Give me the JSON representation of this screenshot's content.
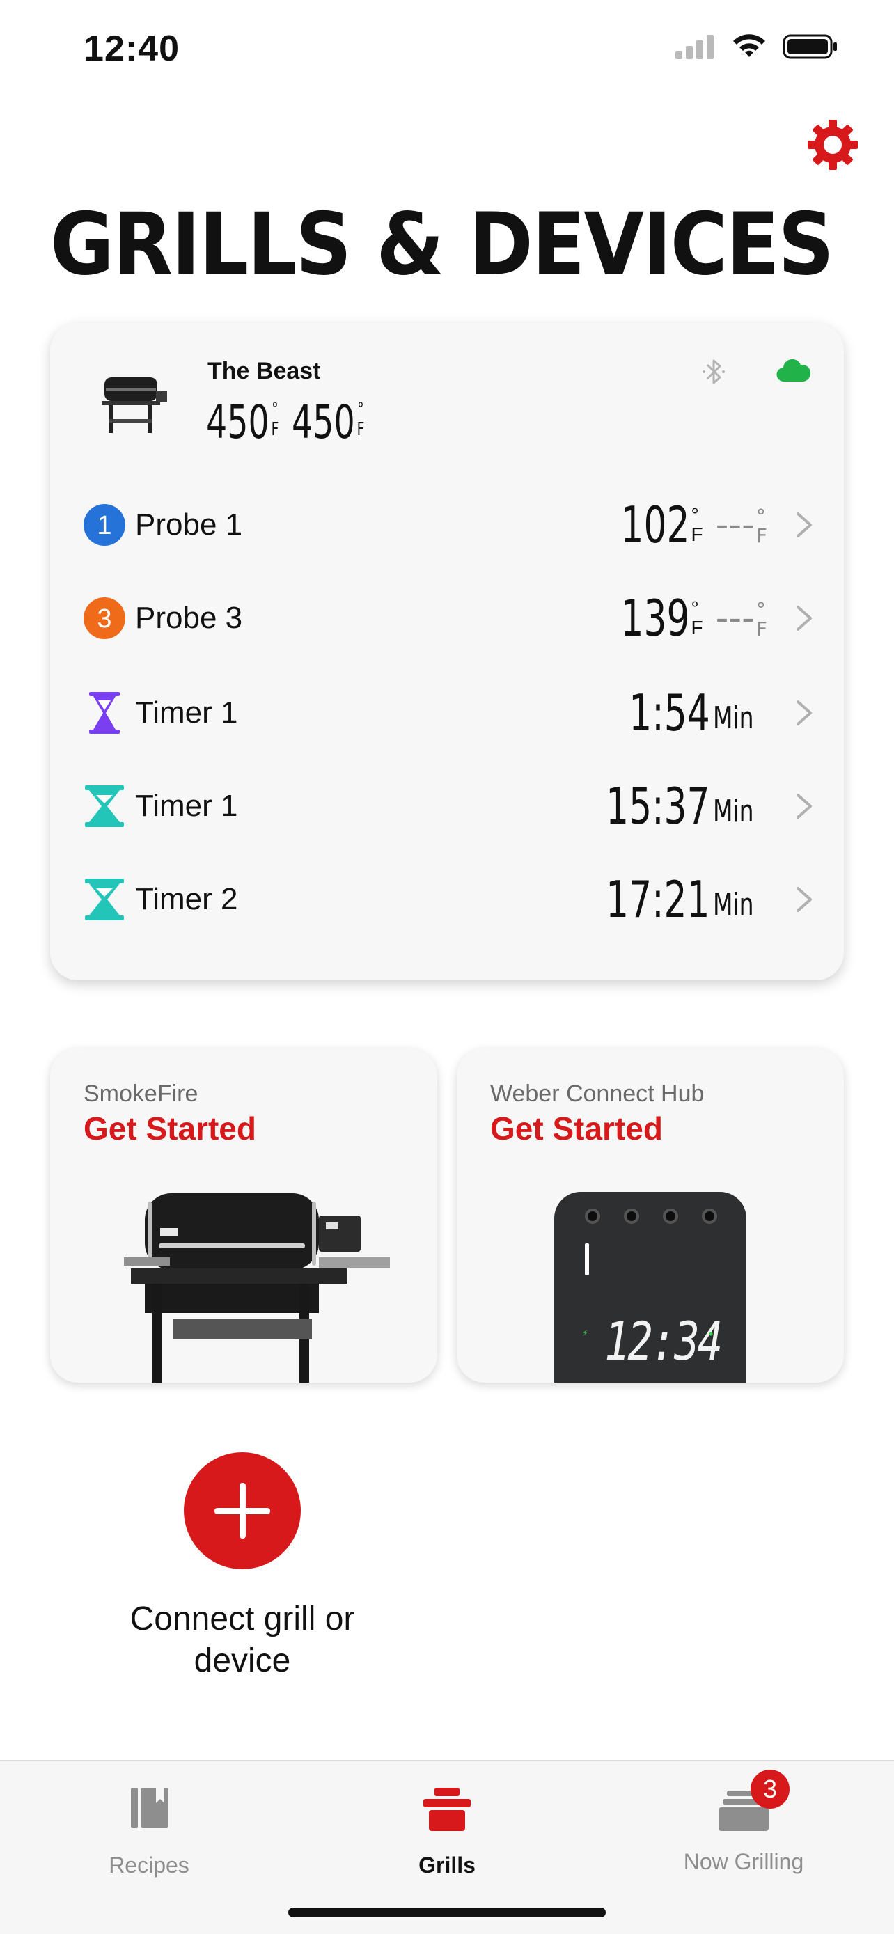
{
  "status_bar": {
    "time": "12:40"
  },
  "header": {
    "title": "GRILLS & DEVICES"
  },
  "grill_card": {
    "name": "The Beast",
    "temps": [
      {
        "value": "450",
        "degree": "°",
        "unit": "F"
      },
      {
        "value": "450",
        "degree": "°",
        "unit": "F"
      }
    ],
    "rows": [
      {
        "badge": "1",
        "badge_color": "#2573d8",
        "label": "Probe 1",
        "value": "102",
        "degree": "°",
        "unit": "F",
        "target": "---",
        "target_degree": "°",
        "target_unit": "F"
      },
      {
        "badge": "3",
        "badge_color": "#ef6b1a",
        "label": "Probe 3",
        "value": "139",
        "degree": "°",
        "unit": "F",
        "target": "---",
        "target_degree": "°",
        "target_unit": "F"
      },
      {
        "icon": "hourglass-icon",
        "icon_color": "#7a3ff0",
        "label": "Timer 1",
        "value": "1:54",
        "unit": "Min"
      },
      {
        "icon": "hourglass-icon",
        "icon_color": "#22c5b8",
        "label": "Timer 1",
        "value": "15:37",
        "unit": "Min"
      },
      {
        "icon": "hourglass-icon",
        "icon_color": "#22c5b8",
        "label": "Timer 2",
        "value": "17:21",
        "unit": "Min"
      }
    ]
  },
  "tiles": [
    {
      "subtitle": "SmokeFire",
      "cta": "Get Started"
    },
    {
      "subtitle": "Weber Connect Hub",
      "cta": "Get Started",
      "display_time": "12:34"
    }
  ],
  "add_device": {
    "label": "Connect grill or device"
  },
  "tabbar": {
    "tabs": [
      {
        "label": "Recipes"
      },
      {
        "label": "Grills"
      },
      {
        "label": "Now Grilling",
        "badge": "3"
      }
    ]
  },
  "colors": {
    "accent": "#d7191b",
    "connected": "#21b24a"
  }
}
